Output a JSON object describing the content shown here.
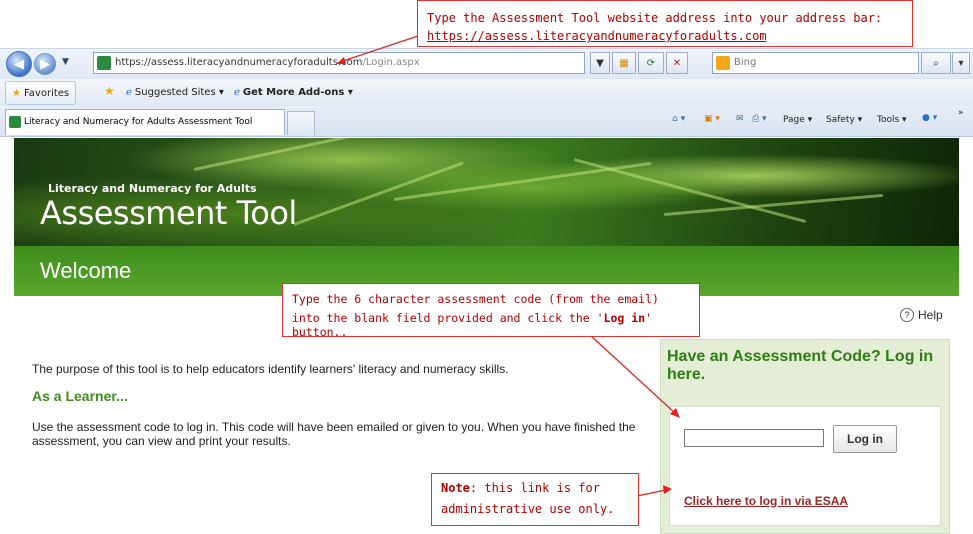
{
  "browser": {
    "address_url_main": "https://assess.literacyandnumeracyforadults.com",
    "address_url_path": "/Login.aspx",
    "search_placeholder": "Bing",
    "favorites_label": "Favorites",
    "suggested_sites_label": "Suggested Sites ▾",
    "get_more_addons_label": "Get More Add-ons ▾",
    "tab_title": "Literacy and Numeracy for Adults Assessment Tool",
    "commands": {
      "page": "Page ▾",
      "safety": "Safety ▾",
      "tools": "Tools ▾"
    }
  },
  "banner": {
    "subtitle": "Literacy and Numeracy for Adults",
    "title": "Assessment Tool"
  },
  "welcome": {
    "heading": "Welcome"
  },
  "help": {
    "label": "Help",
    "icon": "?"
  },
  "main": {
    "purpose": "The purpose of this tool is to help educators identify learners' literacy and numeracy skills.",
    "learner_heading": "As a Learner...",
    "learner_text": "Use the assessment code to log in. This code will have been emailed or given to you. When you have finished the assessment, you can view and print your results."
  },
  "login": {
    "heading": "Have an Assessment Code? Log in here.",
    "code_value": "",
    "button_label": "Log in",
    "esaa_link": "Click here to log in via ESAA"
  },
  "callouts": {
    "top_line1": "Type the Assessment Tool website address into your address bar:",
    "top_line2": "https://assess.literacyandnumeracyforadults.com",
    "mid_line1": "Type the 6 character assessment code (from the email)",
    "mid_line2_a": "into the blank field provided and click the '",
    "mid_line2_b": "Log in",
    "mid_line2_c": "' button..",
    "note_bold": "Note",
    "note_line1_rest": ": this link is for",
    "note_line2": "administrative use only."
  },
  "colors": {
    "brand_green": "#3f8d1e",
    "callout_red": "#b00000",
    "panel_bg": "#e4edd6",
    "link_red": "#9b2626"
  }
}
